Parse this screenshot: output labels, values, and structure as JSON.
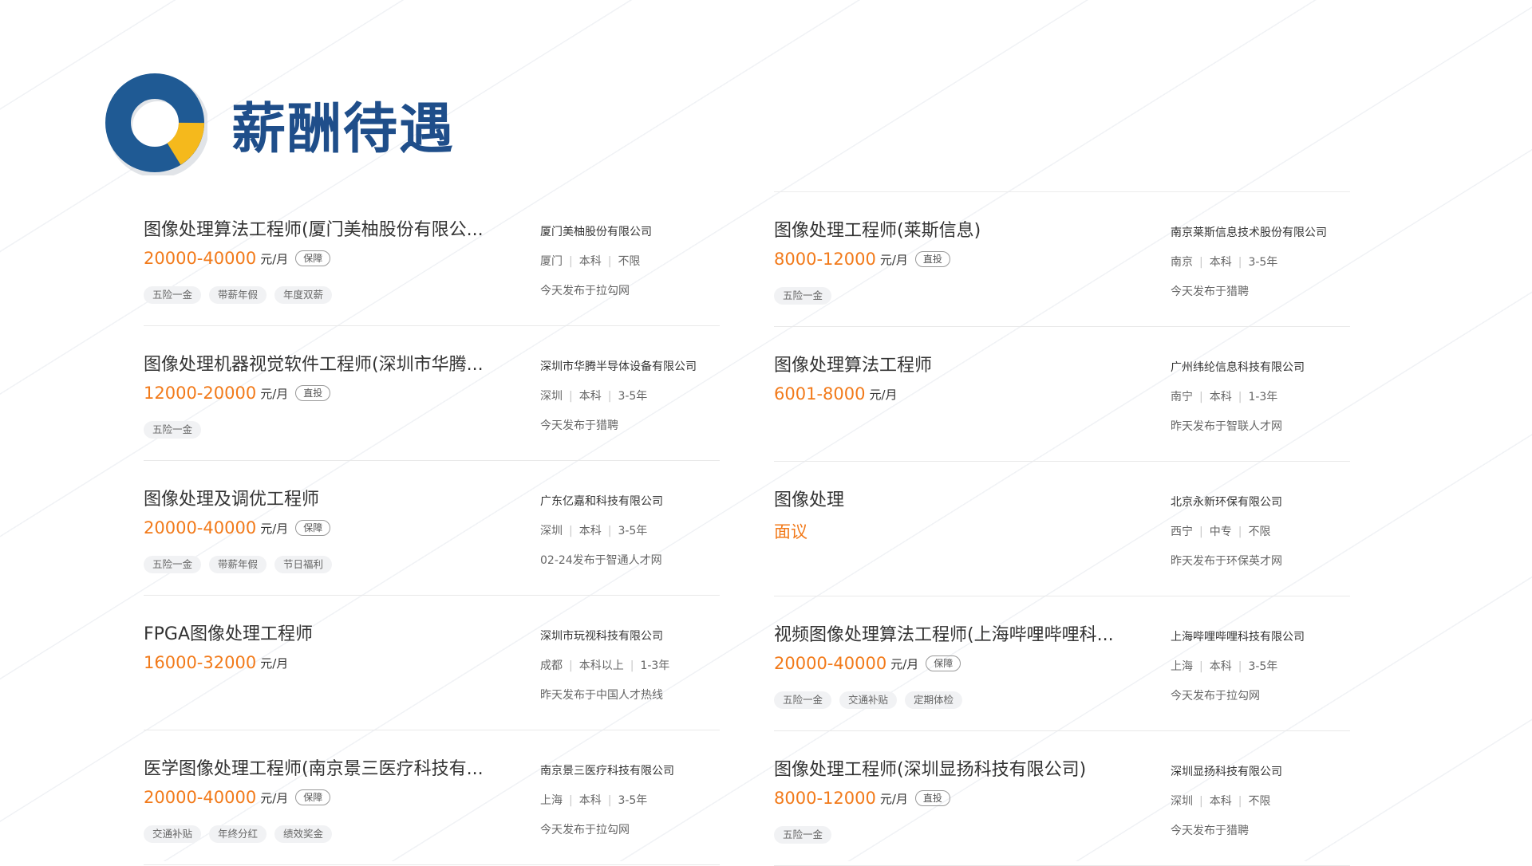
{
  "page": {
    "title": "薪酬待遇",
    "colors": {
      "title": "#1f4e8a",
      "logo_primary": "#1f5a94",
      "logo_accent": "#f5b91c",
      "salary": "#f27a1a"
    }
  },
  "logo_icon": "donut-ring-logo",
  "jobs_left": [
    {
      "title": "图像处理算法工程师(厦门美柚股份有限公...",
      "salary": "20000-40000",
      "unit": "元/月",
      "badge": "保障",
      "tags": [
        "五险一金",
        "带薪年假",
        "年度双薪"
      ],
      "company": "厦门美柚股份有限公司",
      "location": "厦门",
      "education": "本科",
      "experience": "不限",
      "posted": "今天发布于拉勾网"
    },
    {
      "title": "图像处理机器视觉软件工程师(深圳市华腾...",
      "salary": "12000-20000",
      "unit": "元/月",
      "badge": "直投",
      "tags": [
        "五险一金"
      ],
      "company": "深圳市华腾半导体设备有限公司",
      "location": "深圳",
      "education": "本科",
      "experience": "3-5年",
      "posted": "今天发布于猎聘"
    },
    {
      "title": "图像处理及调优工程师",
      "salary": "20000-40000",
      "unit": "元/月",
      "badge": "保障",
      "tags": [
        "五险一金",
        "带薪年假",
        "节日福利"
      ],
      "company": "广东亿嘉和科技有限公司",
      "location": "深圳",
      "education": "本科",
      "experience": "3-5年",
      "posted": "02-24发布于智通人才网"
    },
    {
      "title": "FPGA图像处理工程师",
      "salary": "16000-32000",
      "unit": "元/月",
      "badge": "",
      "tags": [],
      "company": "深圳市玩视科技有限公司",
      "location": "成都",
      "education": "本科以上",
      "experience": "1-3年",
      "posted": "昨天发布于中国人才热线"
    },
    {
      "title": "医学图像处理工程师(南京景三医疗科技有...",
      "salary": "20000-40000",
      "unit": "元/月",
      "badge": "保障",
      "tags": [
        "交通补贴",
        "年终分红",
        "绩效奖金"
      ],
      "company": "南京景三医疗科技有限公司",
      "location": "上海",
      "education": "本科",
      "experience": "3-5年",
      "posted": "今天发布于拉勾网"
    }
  ],
  "jobs_right": [
    {
      "title": "图像处理工程师(莱斯信息)",
      "salary": "8000-12000",
      "unit": "元/月",
      "badge": "直投",
      "tags": [
        "五险一金"
      ],
      "company": "南京莱斯信息技术股份有限公司",
      "location": "南京",
      "education": "本科",
      "experience": "3-5年",
      "posted": "今天发布于猎聘"
    },
    {
      "title": "图像处理算法工程师",
      "salary": "6001-8000",
      "unit": "元/月",
      "badge": "",
      "tags": [],
      "company": "广州纬纶信息科技有限公司",
      "location": "南宁",
      "education": "本科",
      "experience": "1-3年",
      "posted": "昨天发布于智联人才网"
    },
    {
      "title": "图像处理",
      "salary": "面议",
      "unit": "",
      "badge": "",
      "tags": [],
      "company": "北京永新环保有限公司",
      "location": "西宁",
      "education": "中专",
      "experience": "不限",
      "posted": "昨天发布于环保英才网"
    },
    {
      "title": "视频图像处理算法工程师(上海哔哩哔哩科...",
      "salary": "20000-40000",
      "unit": "元/月",
      "badge": "保障",
      "tags": [
        "五险一金",
        "交通补贴",
        "定期体检"
      ],
      "company": "上海哔哩哔哩科技有限公司",
      "location": "上海",
      "education": "本科",
      "experience": "3-5年",
      "posted": "今天发布于拉勾网"
    },
    {
      "title": "图像处理工程师(深圳显扬科技有限公司)",
      "salary": "8000-12000",
      "unit": "元/月",
      "badge": "直投",
      "tags": [
        "五险一金"
      ],
      "company": "深圳显扬科技有限公司",
      "location": "深圳",
      "education": "本科",
      "experience": "不限",
      "posted": "今天发布于猎聘"
    }
  ]
}
